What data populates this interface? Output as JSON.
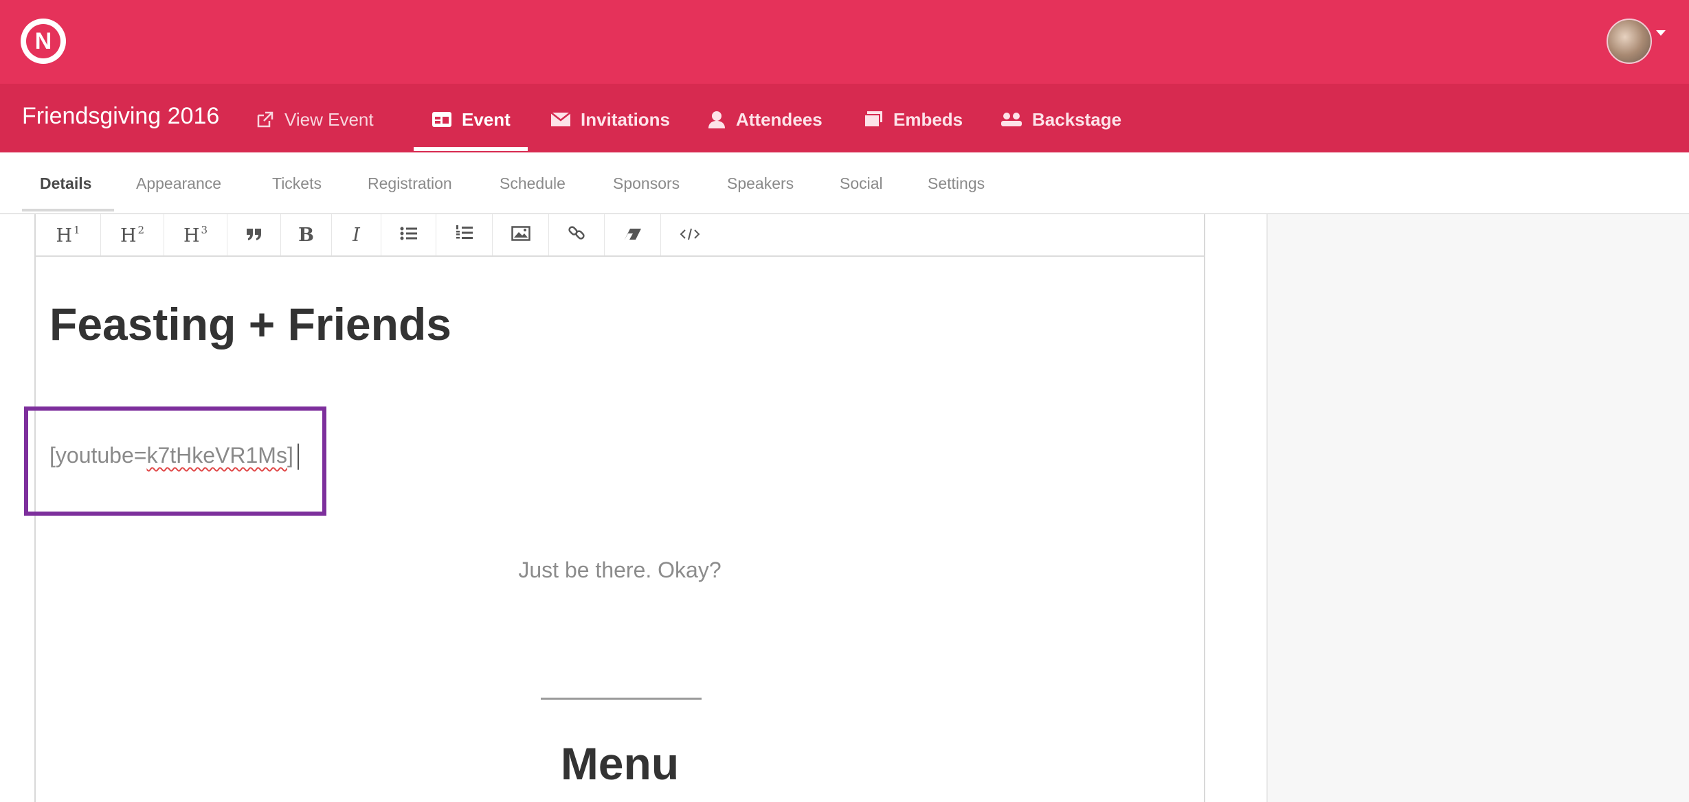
{
  "app": {
    "logo_letter": "N",
    "brand_color": "#e5325a"
  },
  "event_nav": {
    "event_title": "Friendsgiving 2016",
    "items": [
      {
        "label": "View Event",
        "icon": "external-link-icon"
      },
      {
        "label": "Event",
        "icon": "calendar-icon",
        "active": true
      },
      {
        "label": "Invitations",
        "icon": "envelope-icon"
      },
      {
        "label": "Attendees",
        "icon": "person-icon"
      },
      {
        "label": "Embeds",
        "icon": "stack-icon"
      },
      {
        "label": "Backstage",
        "icon": "people-icon"
      }
    ]
  },
  "sub_tabs": [
    {
      "label": "Details",
      "active": true
    },
    {
      "label": "Appearance"
    },
    {
      "label": "Tickets"
    },
    {
      "label": "Registration"
    },
    {
      "label": "Schedule"
    },
    {
      "label": "Sponsors"
    },
    {
      "label": "Speakers"
    },
    {
      "label": "Social"
    },
    {
      "label": "Settings"
    }
  ],
  "toolbar": {
    "h1": "H",
    "h1_sup": "1",
    "h2": "H",
    "h2_sup": "2",
    "h3": "H",
    "h3_sup": "3",
    "bold": "B",
    "italic": "I",
    "tools": [
      "heading1-icon",
      "heading2-icon",
      "heading3-icon",
      "quote-icon",
      "bold-icon",
      "italic-icon",
      "bullet-list-icon",
      "numbered-list-icon",
      "image-icon",
      "link-icon",
      "eraser-icon",
      "code-icon"
    ]
  },
  "content": {
    "heading": "Feasting + Friends",
    "shortcode_prefix": "[youtube=",
    "shortcode_id": "k7tHkeVR1Ms",
    "shortcode_suffix": "]",
    "tagline": "Just be there. Okay?",
    "menu_heading": "Menu"
  },
  "colors": {
    "highlight": "#7d2f9c",
    "event_bar": "#d72a50"
  }
}
